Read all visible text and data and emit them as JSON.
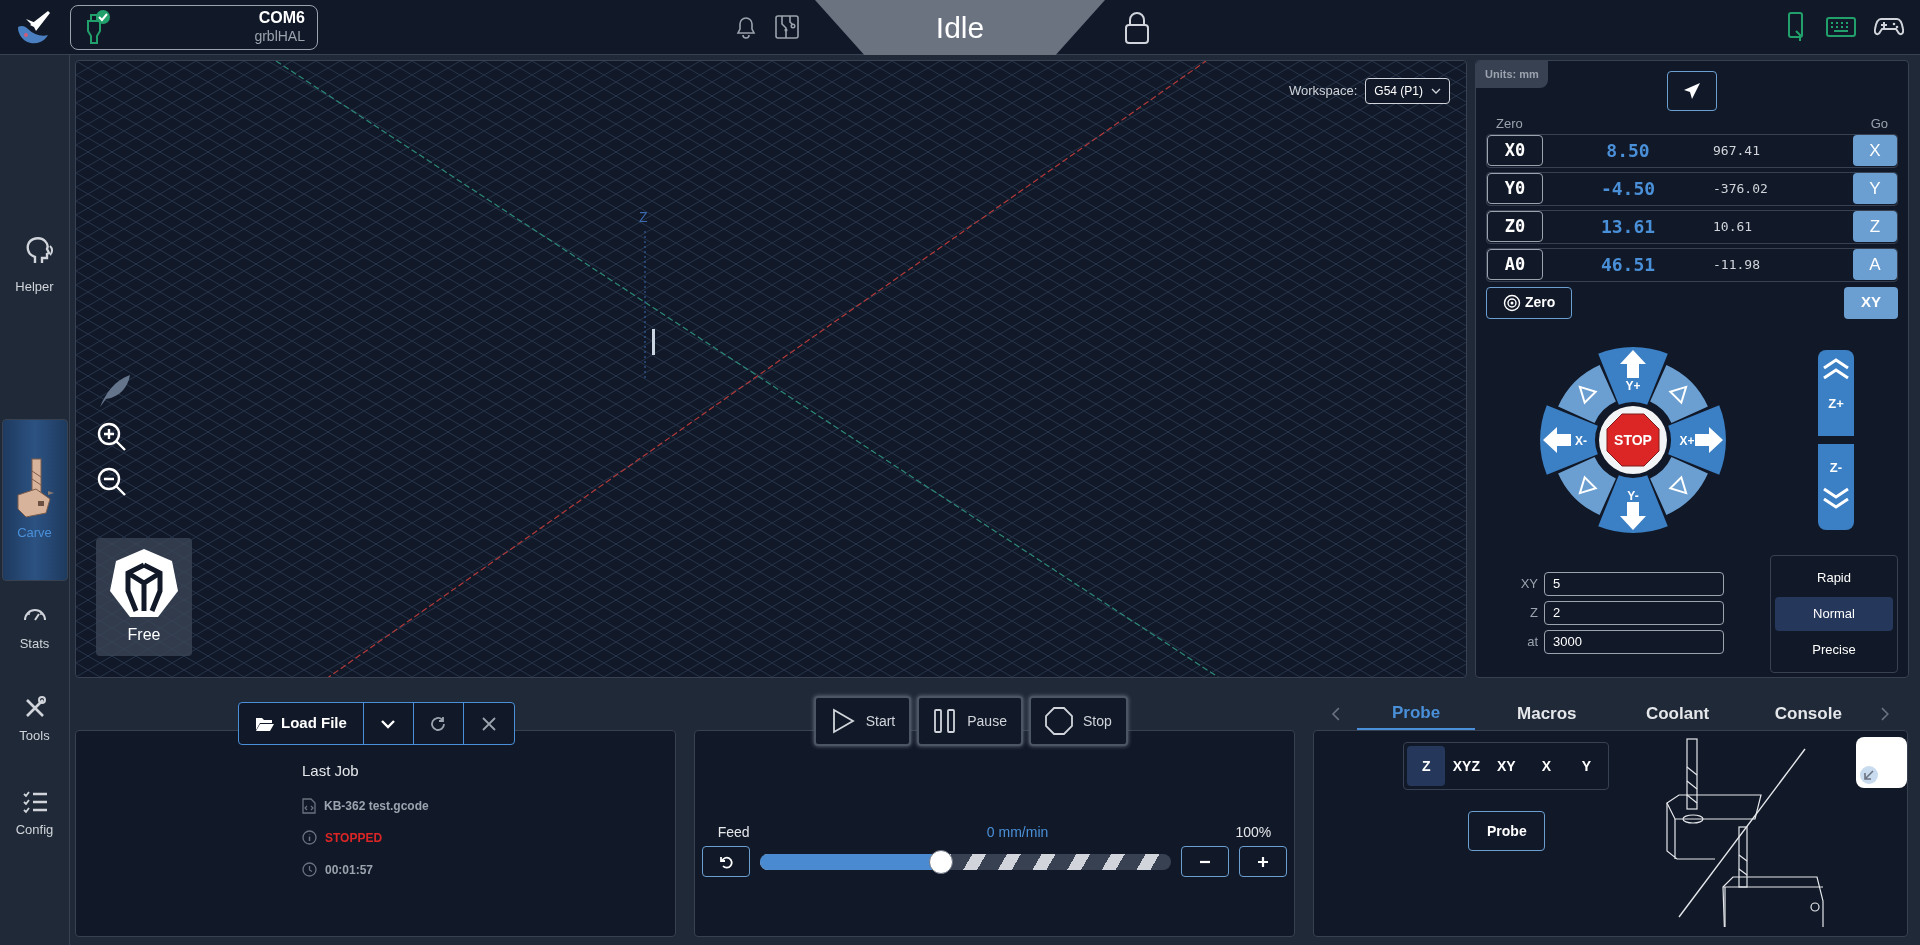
{
  "connection": {
    "port": "COM6",
    "firmware": "grblHAL",
    "connected": true
  },
  "status": {
    "label": "Idle"
  },
  "sidebar": {
    "items": [
      {
        "kind": "helper",
        "label": "Helper",
        "selected": false
      },
      {
        "kind": "carve",
        "label": "Carve",
        "selected": true
      },
      {
        "kind": "stats",
        "label": "Stats",
        "selected": false
      },
      {
        "kind": "tools",
        "label": "Tools",
        "selected": false
      },
      {
        "kind": "config",
        "label": "Config",
        "selected": false
      }
    ]
  },
  "visualizer": {
    "workspace_label": "Workspace:",
    "workspace_value": "G54 (P1)",
    "axis_label": "Z",
    "camera_label": "Free"
  },
  "dro": {
    "units": "Units: mm",
    "zero_header": "Zero",
    "go_header": "Go",
    "zero_all": "Zero",
    "go_xy": "XY",
    "axes": [
      {
        "zero": "X0",
        "work": "8.50",
        "machine": "967.41",
        "go": "X"
      },
      {
        "zero": "Y0",
        "work": "-4.50",
        "machine": "-376.02",
        "go": "Y"
      },
      {
        "zero": "Z0",
        "work": "13.61",
        "machine": "10.61",
        "go": "Z"
      },
      {
        "zero": "A0",
        "work": "46.51",
        "machine": "-11.98",
        "go": "A"
      }
    ]
  },
  "jog": {
    "y_plus": "Y+",
    "y_minus": "Y-",
    "x_minus": "X-",
    "x_plus": "X+",
    "stop": "STOP",
    "z_plus": "Z+",
    "z_minus": "Z-",
    "fields": [
      {
        "label": "XY",
        "value": "5"
      },
      {
        "label": "Z",
        "value": "2"
      },
      {
        "label": "at",
        "value": "3000"
      }
    ],
    "speeds": [
      {
        "label": "Rapid",
        "selected": false
      },
      {
        "label": "Normal",
        "selected": true
      },
      {
        "label": "Precise",
        "selected": false
      }
    ]
  },
  "job": {
    "load_button": "Load File",
    "heading": "Last Job",
    "file": "KB-362 test.gcode",
    "state": "STOPPED",
    "elapsed": "00:01:57"
  },
  "controls": {
    "buttons": [
      {
        "kind": "start",
        "label": "Start"
      },
      {
        "kind": "pause",
        "label": "Pause"
      },
      {
        "kind": "stop",
        "label": "Stop"
      }
    ],
    "feed_label": "Feed",
    "feed_rate": "0 mm/min",
    "feed_percent": "100%",
    "level": 0.44
  },
  "tabs": [
    {
      "label": "Probe",
      "selected": true
    },
    {
      "label": "Macros",
      "selected": false
    },
    {
      "label": "Coolant",
      "selected": false
    },
    {
      "label": "Console",
      "selected": false
    }
  ],
  "probe": {
    "axes": [
      {
        "label": "Z",
        "selected": true
      },
      {
        "label": "XYZ",
        "selected": false
      },
      {
        "label": "XY",
        "selected": false
      },
      {
        "label": "X",
        "selected": false
      },
      {
        "label": "Y",
        "selected": false
      }
    ],
    "button": "Probe"
  }
}
